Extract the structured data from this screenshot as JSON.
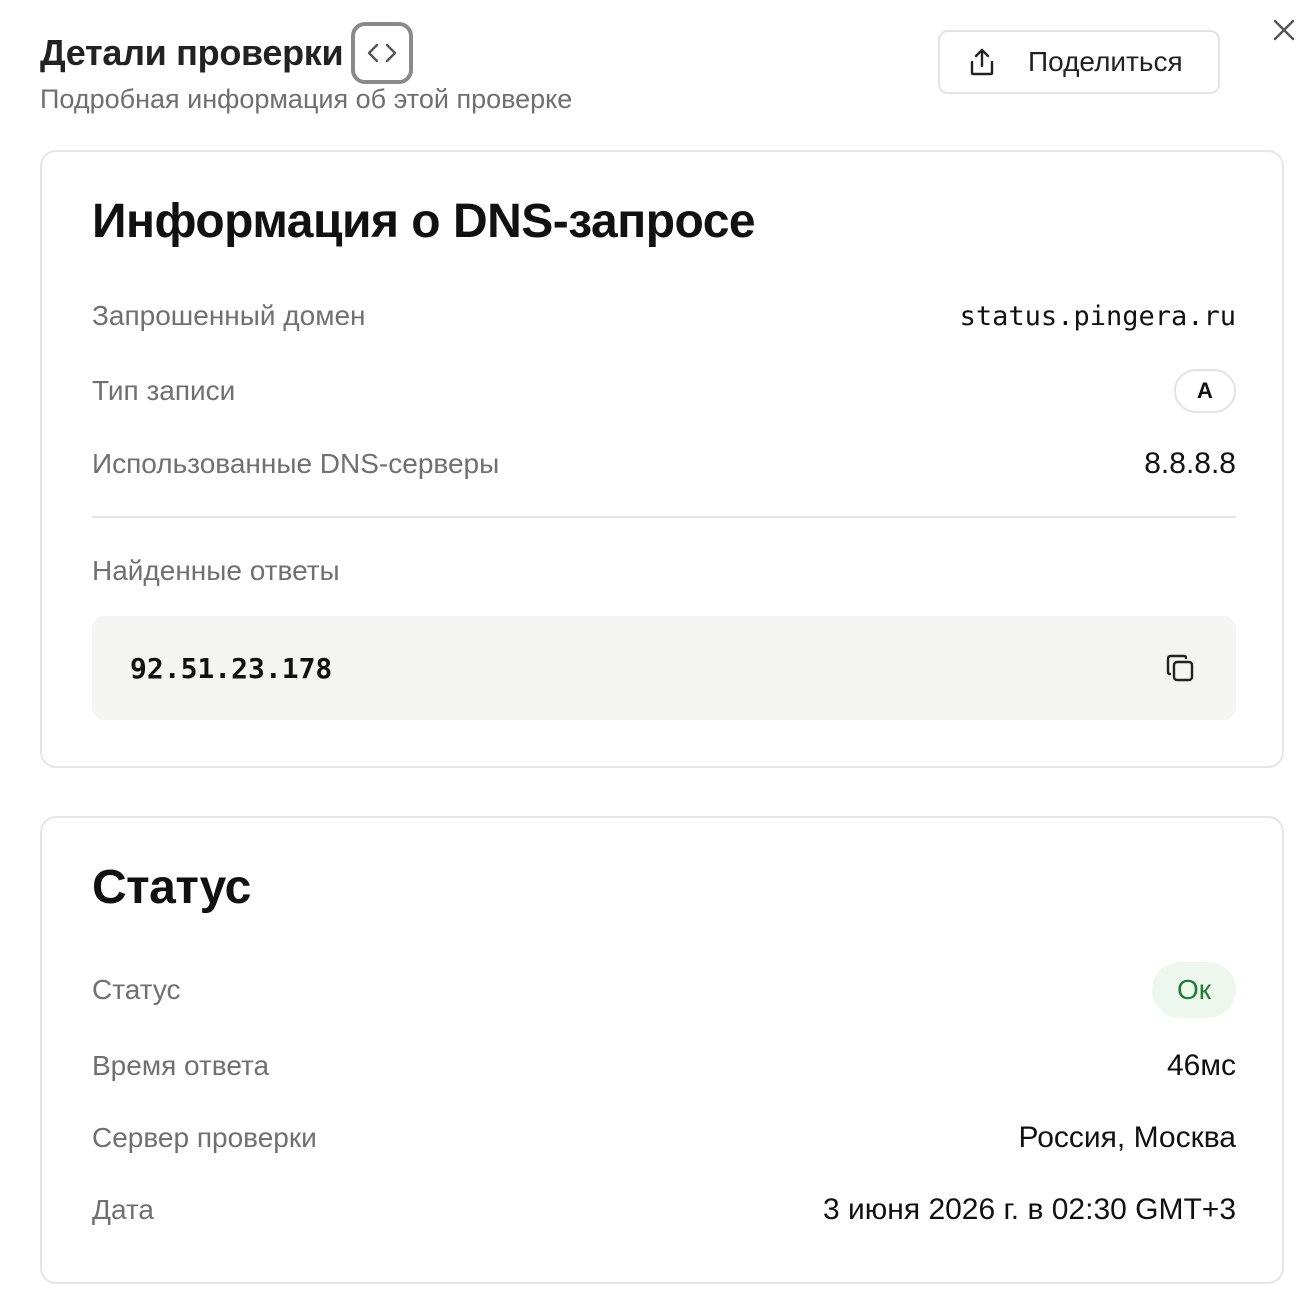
{
  "header": {
    "title": "Детали проверки",
    "subtitle": "Подробная информация об этой проверке",
    "share_label": "Поделиться"
  },
  "dns": {
    "title": "Информация о DNS-запросе",
    "rows": [
      {
        "label": "Запрошенный домен",
        "value": "status.pingera.ru"
      },
      {
        "label": "Тип записи",
        "value": "A"
      },
      {
        "label": "Использованные DNS-серверы",
        "value": "8.8.8.8"
      }
    ],
    "answers_label": "Найденные ответы",
    "answers": [
      "92.51.23.178"
    ]
  },
  "status": {
    "title": "Статус",
    "rows": [
      {
        "label": "Статус",
        "value": "Ок"
      },
      {
        "label": "Время ответа",
        "value": "46мс"
      },
      {
        "label": "Сервер проверки",
        "value": "Россия, Москва"
      },
      {
        "label": "Дата",
        "value": "3 июня 2026 г. в 02:30 GMT+3"
      }
    ]
  },
  "colors": {
    "ok_text": "#1f7a33",
    "ok_background": "#edf7ee",
    "answer_background": "#f4f4f2"
  },
  "icons": {
    "code": "code-brackets-icon",
    "share": "share-upload-icon",
    "close": "close-icon",
    "copy": "copy-icon"
  }
}
